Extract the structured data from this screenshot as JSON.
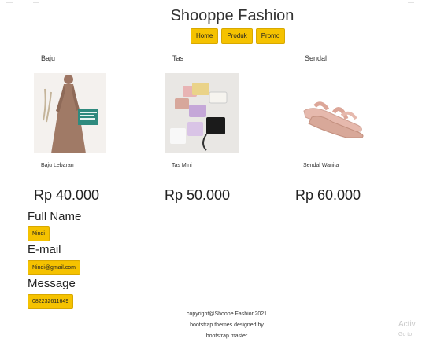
{
  "title": "Shooppe Fashion",
  "nav": {
    "home": "Home",
    "produk": "Produk",
    "promo": "Promo"
  },
  "products": [
    {
      "category": "Baju",
      "name": "Baju Lebaran",
      "price": "Rp 40.000",
      "image": "dress-image"
    },
    {
      "category": "Tas",
      "name": "Tas Mini",
      "price": "Rp 50.000",
      "image": "bags-image"
    },
    {
      "category": "Sendal",
      "name": "Sendal Wanita",
      "price": "Rp 60.000",
      "image": "sandal-image"
    }
  ],
  "form": {
    "name_label": "Full Name",
    "name_value": "Nindi",
    "email_label": "E-mail",
    "email_value": "Nindi@gmail.com",
    "message_label": "Message",
    "message_value": "082232611649"
  },
  "footer": {
    "line1": "copyright@Shoope Fashion2021",
    "line2": "bootstrap themes designed by",
    "line3": "bootstrap master"
  },
  "watermark": {
    "line1": "Activ",
    "line2": "Go to"
  },
  "colors": {
    "accent": "#f5c200",
    "dress": "#a07a66",
    "sandal": "#e6b9ad"
  }
}
